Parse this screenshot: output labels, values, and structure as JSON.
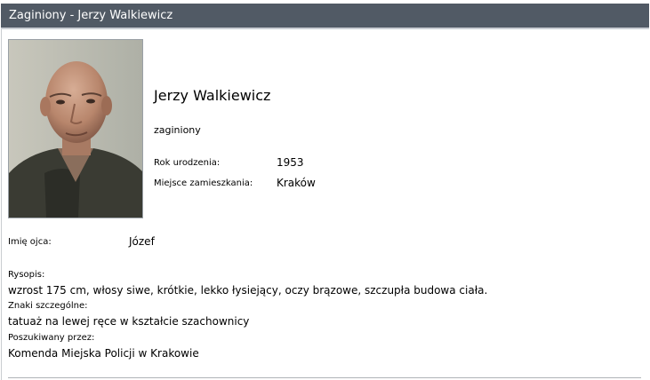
{
  "window": {
    "title": "Zaginiony - Jerzy Walkiewicz"
  },
  "person": {
    "name": "Jerzy Walkiewicz",
    "status": "zaginiony",
    "birth_year_label": "Rok urodzenia:",
    "birth_year": "1953",
    "residence_label": "Miejsce zamieszkania:",
    "residence": "Kraków",
    "father_name_label": "Imię ojca:",
    "father_name": "Józef"
  },
  "details": {
    "description_label": "Rysopis:",
    "description": "wzrost 175 cm, włosy siwe, krótkie, lekko łysiejący, oczy brązowe, szczupła budowa ciała.",
    "marks_label": "Znaki szczególne:",
    "marks": "tatuaż na lewej ręce w kształcie szachownicy",
    "searched_by_label": "Poszukiwany przez:",
    "searched_by": "Komenda Miejska Policji w Krakowie"
  }
}
